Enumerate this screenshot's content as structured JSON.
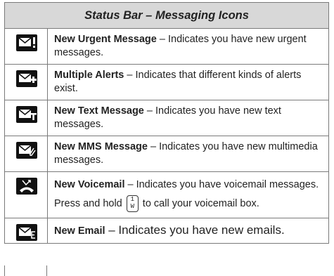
{
  "table": {
    "title": "Status Bar – Messaging Icons",
    "rows": [
      {
        "icon": "urgent-message-icon",
        "name": "New Urgent Message",
        "desc": " – Indicates you have new urgent messages."
      },
      {
        "icon": "multiple-alerts-icon",
        "name": "Multiple Alerts",
        "desc": " – Indicates that different kinds of alerts exist."
      },
      {
        "icon": "text-message-icon",
        "name": "New Text Message",
        "desc": " – Indicates you have new text messages."
      },
      {
        "icon": "mms-message-icon",
        "name": "New MMS Message",
        "desc": " – Indicates you have new multimedia messages."
      },
      {
        "icon": "voicemail-icon",
        "name": "New Voicemail",
        "desc_a": " – Indicates you have voicemail messages. Press and hold ",
        "key_top": "1",
        "key_bottom": "W",
        "desc_b": " to call your voicemail box."
      },
      {
        "icon": "email-icon",
        "name": "New Email",
        "desc": " – Indicates you have new emails."
      }
    ]
  }
}
